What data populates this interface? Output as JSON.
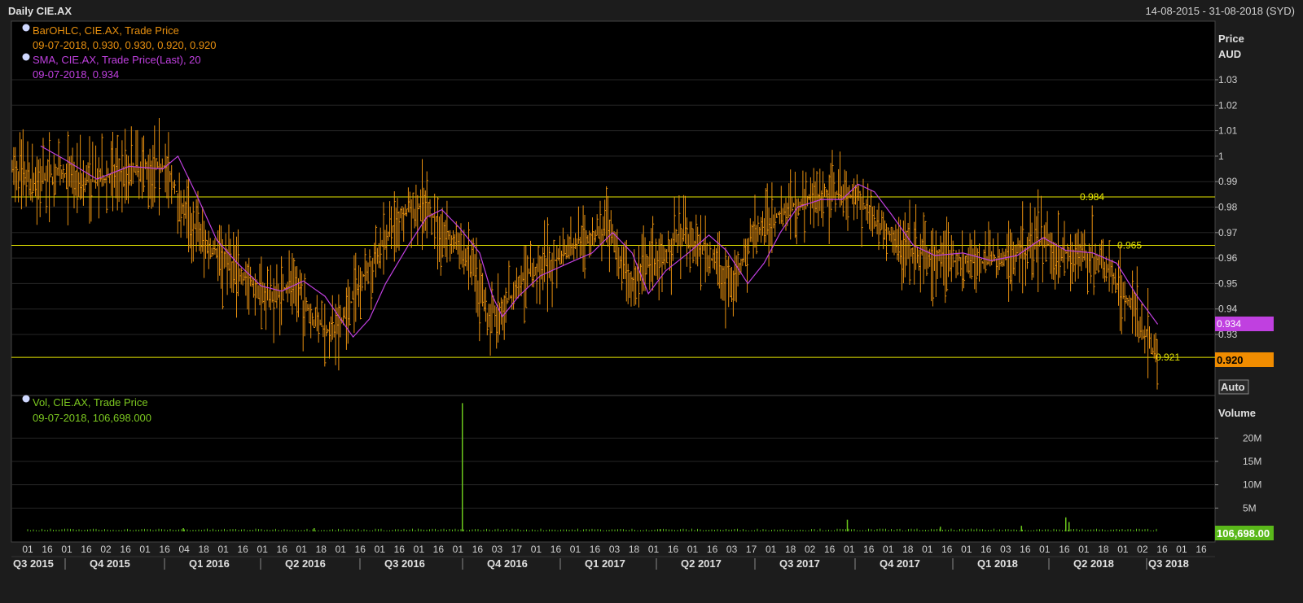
{
  "window": {
    "title": "Daily CIE.AX",
    "date_range": "14-08-2015 - 31-08-2018 (SYD)"
  },
  "price_panel": {
    "axis_title": "Price",
    "axis_unit": "AUD",
    "auto_label": "Auto",
    "legend": [
      {
        "name": "BarOHLC, CIE.AX, Trade Price",
        "values": "09-07-2018, 0.930, 0.930, 0.920, 0.920",
        "color": "#e8900f"
      },
      {
        "name": "SMA, CIE.AX, Trade Price(Last),  20",
        "values": "09-07-2018, 0.934",
        "color": "#c040e0"
      }
    ],
    "y_ticks": [
      "1.03",
      "1.02",
      "1.01",
      "1",
      "0.99",
      "0.98",
      "0.97",
      "0.96",
      "0.95",
      "0.94",
      "0.93"
    ],
    "last_sma_tag": "0.934",
    "last_price_tag": "0.920"
  },
  "volume_panel": {
    "axis_title": "Volume",
    "legend": {
      "name": "Vol, CIE.AX, Trade Price",
      "values": "09-07-2018, 106,698.000",
      "color": "#7cc820"
    },
    "y_ticks": [
      "20M",
      "15M",
      "10M",
      "5M"
    ],
    "last_volume_tag": "106,698.00"
  },
  "x_axis": {
    "day_ticks": [
      "01",
      "16",
      "01",
      "16",
      "02",
      "16",
      "01",
      "16",
      "04",
      "18",
      "01",
      "16",
      "01",
      "16",
      "01",
      "18",
      "01",
      "16",
      "01",
      "16",
      "01",
      "16",
      "01",
      "16",
      "03",
      "17",
      "01",
      "16",
      "01",
      "16",
      "03",
      "18",
      "01",
      "16",
      "01",
      "16",
      "03",
      "17",
      "01",
      "18",
      "02",
      "16",
      "01",
      "16",
      "01",
      "18",
      "01",
      "16",
      "01",
      "16",
      "03",
      "16",
      "01",
      "16",
      "01",
      "18",
      "01",
      "02",
      "16",
      "01",
      "16"
    ],
    "quarters": [
      "Q3 2015",
      "Q4 2015",
      "Q1 2016",
      "Q2 2016",
      "Q3 2016",
      "Q4 2016",
      "Q1 2017",
      "Q2 2017",
      "Q3 2017",
      "Q4 2017",
      "Q1 2018",
      "Q2 2018",
      "Q3 2018"
    ]
  },
  "chart_data": [
    {
      "type": "ohlc-bar",
      "title": "Daily CIE.AX",
      "series": [
        {
          "name": "BarOHLC, CIE.AX, Trade Price",
          "last": {
            "date": "09-07-2018",
            "open": 0.93,
            "high": 0.93,
            "low": 0.92,
            "close": 0.92
          }
        },
        {
          "name": "SMA, CIE.AX, Trade Price(Last),  20",
          "last": {
            "date": "09-07-2018",
            "value": 0.934
          }
        }
      ],
      "approx_close_path": [
        [
          "2015-08-14",
          0.995
        ],
        [
          "2015-09-01",
          0.99
        ],
        [
          "2015-10-01",
          0.993
        ],
        [
          "2015-11-01",
          0.99
        ],
        [
          "2015-12-01",
          0.995
        ],
        [
          "2016-01-01",
          0.997
        ],
        [
          "2016-01-20",
          0.98
        ],
        [
          "2016-02-10",
          0.965
        ],
        [
          "2016-03-01",
          0.96
        ],
        [
          "2016-03-20",
          0.95
        ],
        [
          "2016-04-10",
          0.945
        ],
        [
          "2016-05-01",
          0.95
        ],
        [
          "2016-05-20",
          0.935
        ],
        [
          "2016-06-10",
          0.93
        ],
        [
          "2016-07-01",
          0.95
        ],
        [
          "2016-07-20",
          0.965
        ],
        [
          "2016-08-10",
          0.978
        ],
        [
          "2016-09-01",
          0.98
        ],
        [
          "2016-09-20",
          0.968
        ],
        [
          "2016-10-10",
          0.96
        ],
        [
          "2016-10-25",
          0.938
        ],
        [
          "2016-11-10",
          0.94
        ],
        [
          "2016-12-01",
          0.953
        ],
        [
          "2017-01-01",
          0.96
        ],
        [
          "2017-01-25",
          0.968
        ],
        [
          "2017-02-15",
          0.97
        ],
        [
          "2017-03-10",
          0.95
        ],
        [
          "2017-04-01",
          0.96
        ],
        [
          "2017-04-25",
          0.968
        ],
        [
          "2017-05-15",
          0.963
        ],
        [
          "2017-06-10",
          0.95
        ],
        [
          "2017-07-01",
          0.97
        ],
        [
          "2017-08-01",
          0.98
        ],
        [
          "2017-09-01",
          0.985
        ],
        [
          "2017-10-01",
          0.985
        ],
        [
          "2017-10-20",
          0.975
        ],
        [
          "2017-11-15",
          0.963
        ],
        [
          "2017-12-15",
          0.96
        ],
        [
          "2018-01-20",
          0.958
        ],
        [
          "2018-02-20",
          0.96
        ],
        [
          "2018-03-20",
          0.967
        ],
        [
          "2018-04-20",
          0.962
        ],
        [
          "2018-05-15",
          0.96
        ],
        [
          "2018-06-10",
          0.945
        ],
        [
          "2018-07-09",
          0.92
        ]
      ],
      "approx_sma_path": [
        [
          "2015-09-10",
          1.004
        ],
        [
          "2015-10-01",
          0.999
        ],
        [
          "2015-11-01",
          0.991
        ],
        [
          "2015-12-01",
          0.996
        ],
        [
          "2016-01-01",
          0.995
        ],
        [
          "2016-01-15",
          1.0
        ],
        [
          "2016-02-01",
          0.985
        ],
        [
          "2016-02-20",
          0.967
        ],
        [
          "2016-03-10",
          0.958
        ],
        [
          "2016-04-01",
          0.949
        ],
        [
          "2016-04-20",
          0.947
        ],
        [
          "2016-05-10",
          0.951
        ],
        [
          "2016-05-30",
          0.945
        ],
        [
          "2016-06-15",
          0.935
        ],
        [
          "2016-06-25",
          0.929
        ],
        [
          "2016-07-10",
          0.936
        ],
        [
          "2016-07-25",
          0.95
        ],
        [
          "2016-08-15",
          0.965
        ],
        [
          "2016-09-01",
          0.976
        ],
        [
          "2016-09-15",
          0.979
        ],
        [
          "2016-10-01",
          0.972
        ],
        [
          "2016-10-20",
          0.962
        ],
        [
          "2016-11-01",
          0.945
        ],
        [
          "2016-11-10",
          0.937
        ],
        [
          "2016-11-25",
          0.945
        ],
        [
          "2016-12-15",
          0.953
        ],
        [
          "2017-01-10",
          0.958
        ],
        [
          "2017-02-01",
          0.962
        ],
        [
          "2017-02-20",
          0.97
        ],
        [
          "2017-03-10",
          0.962
        ],
        [
          "2017-03-25",
          0.946
        ],
        [
          "2017-04-10",
          0.955
        ],
        [
          "2017-05-01",
          0.962
        ],
        [
          "2017-05-20",
          0.969
        ],
        [
          "2017-06-05",
          0.963
        ],
        [
          "2017-06-25",
          0.95
        ],
        [
          "2017-07-10",
          0.958
        ],
        [
          "2017-07-25",
          0.97
        ],
        [
          "2017-08-10",
          0.98
        ],
        [
          "2017-09-01",
          0.983
        ],
        [
          "2017-09-20",
          0.983
        ],
        [
          "2017-10-05",
          0.989
        ],
        [
          "2017-10-20",
          0.986
        ],
        [
          "2017-11-05",
          0.977
        ],
        [
          "2017-11-25",
          0.965
        ],
        [
          "2017-12-15",
          0.961
        ],
        [
          "2018-01-10",
          0.962
        ],
        [
          "2018-02-05",
          0.959
        ],
        [
          "2018-03-01",
          0.961
        ],
        [
          "2018-03-25",
          0.968
        ],
        [
          "2018-04-15",
          0.963
        ],
        [
          "2018-05-10",
          0.962
        ],
        [
          "2018-06-01",
          0.958
        ],
        [
          "2018-06-20",
          0.945
        ],
        [
          "2018-07-09",
          0.934
        ]
      ],
      "horizontal_lines": [
        0.984,
        0.965,
        0.921
      ],
      "y_axis": {
        "label": "Price AUD",
        "range": [
          0.911,
          1.041
        ]
      },
      "x_axis": {
        "range": [
          "2015-08-14",
          "2018-08-31"
        ]
      },
      "legend_position": "top-left",
      "grid": true
    },
    {
      "type": "bar",
      "title": "Vol, CIE.AX, Trade Price",
      "series": [
        {
          "name": "Vol, CIE.AX, Trade Price",
          "last": {
            "date": "09-07-2018",
            "value": 106698
          }
        }
      ],
      "approx_volume_spikes": [
        [
          "2016-10-04",
          27500000
        ],
        [
          "2017-09-25",
          2500000
        ],
        [
          "2018-04-15",
          3000000
        ],
        [
          "2018-04-18",
          2000000
        ],
        [
          "2018-03-05",
          1200000
        ],
        [
          "2017-12-20",
          1000000
        ],
        [
          "2016-01-20",
          700000
        ],
        [
          "2016-05-20",
          700000
        ],
        [
          "2017-04-05",
          500000
        ]
      ],
      "baseline_volume": 400000,
      "y_axis": {
        "label": "Volume",
        "range": [
          0,
          30000000
        ]
      },
      "grid": true
    }
  ]
}
